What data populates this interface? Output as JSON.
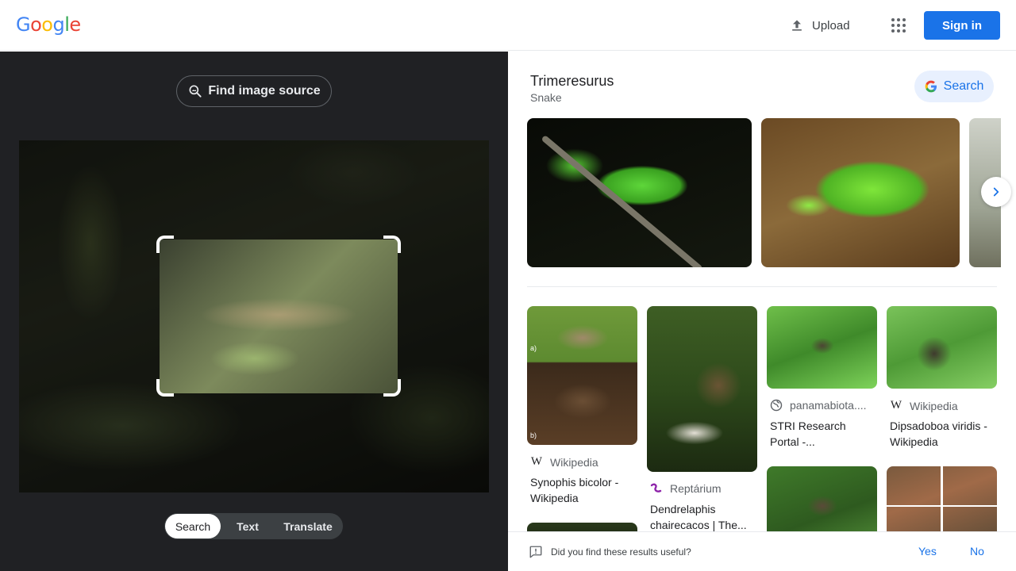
{
  "header": {
    "logo_letters": [
      {
        "ch": "G",
        "color": "#4285f4"
      },
      {
        "ch": "o",
        "color": "#ea4335"
      },
      {
        "ch": "o",
        "color": "#fbbc05"
      },
      {
        "ch": "g",
        "color": "#4285f4"
      },
      {
        "ch": "l",
        "color": "#34a853"
      },
      {
        "ch": "e",
        "color": "#ea4335"
      }
    ],
    "upload_label": "Upload",
    "apps_icon": "apps-grid-icon",
    "signin_label": "Sign in",
    "accent": "#1a73e8"
  },
  "lens": {
    "find_source_label": "Find image source",
    "modes": [
      "Search",
      "Text",
      "Translate"
    ],
    "active_mode": "Search"
  },
  "knowledge": {
    "title": "Trimeresurus",
    "subtitle": "Snake",
    "search_label": "Search"
  },
  "results": [
    {
      "source": "Wikipedia",
      "source_icon": "wikipedia-icon",
      "title": "Synophis bicolor - Wikipedia",
      "thumb_labels": [
        "a)",
        "b)"
      ]
    },
    {
      "source": "Reptárium",
      "source_icon": "reptarium-icon",
      "title": "Dendrelaphis chairecacos | The..."
    },
    {
      "source": "panamabiota....",
      "source_icon": "globe-icon",
      "title": "STRI Research Portal -..."
    },
    {
      "source": "Wikipedia",
      "source_icon": "wikipedia-icon",
      "title": "Dipsadoboa viridis - Wikipedia"
    }
  ],
  "feedback": {
    "question": "Did you find these results useful?",
    "yes": "Yes",
    "no": "No"
  }
}
